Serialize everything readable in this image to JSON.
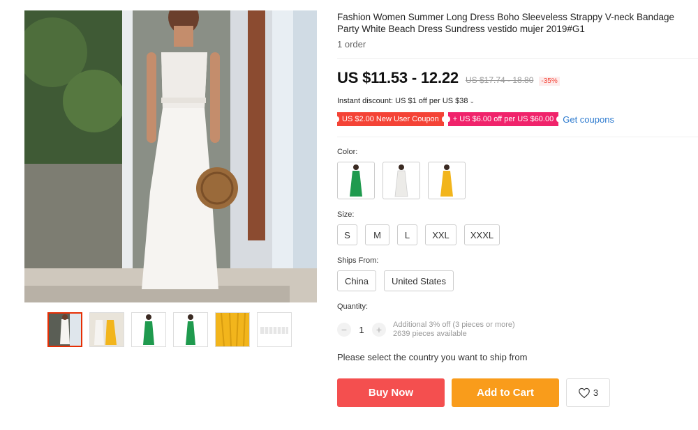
{
  "product": {
    "title": "Fashion Women Summer Long Dress Boho Sleeveless Strappy V-neck Bandage Party White Beach Dress Sundress vestido mujer 2019#G1",
    "orders": "1 order"
  },
  "pricing": {
    "price": "US $11.53 - 12.22",
    "original_price": "US $17.74 - 18.80",
    "discount": "-35%",
    "instant_discount": "Instant discount: US $1 off per US $38",
    "coupons": [
      {
        "label": "US $2.00 New User Coupon"
      },
      {
        "label": "+ US $6.00 off per US $60.00"
      }
    ],
    "get_coupons": "Get coupons"
  },
  "options": {
    "color_label": "Color:",
    "colors": [
      {
        "name": "green",
        "hex": "#1f9a4e"
      },
      {
        "name": "white",
        "hex": "#f2f2f2"
      },
      {
        "name": "yellow",
        "hex": "#f2b51c"
      }
    ],
    "size_label": "Size:",
    "sizes": [
      "S",
      "M",
      "L",
      "XXL",
      "XXXL"
    ],
    "ships_from_label": "Ships From:",
    "ships_from": [
      "China",
      "United States"
    ],
    "quantity_label": "Quantity:",
    "quantity": "1",
    "quantity_note_1": "Additional 3% off (3 pieces or more)",
    "quantity_note_2": "2639 pieces available"
  },
  "ship_message": "Please select the country you want to ship from",
  "actions": {
    "buy_now": "Buy Now",
    "add_to_cart": "Add to Cart",
    "wishlist_count": "3"
  },
  "colors": {
    "price_red": "#f44336",
    "buy_red": "#f44f4f",
    "cart_orange": "#f99c1b",
    "coupon_pink": "#f0236b",
    "link_blue": "#2e7bcf"
  }
}
